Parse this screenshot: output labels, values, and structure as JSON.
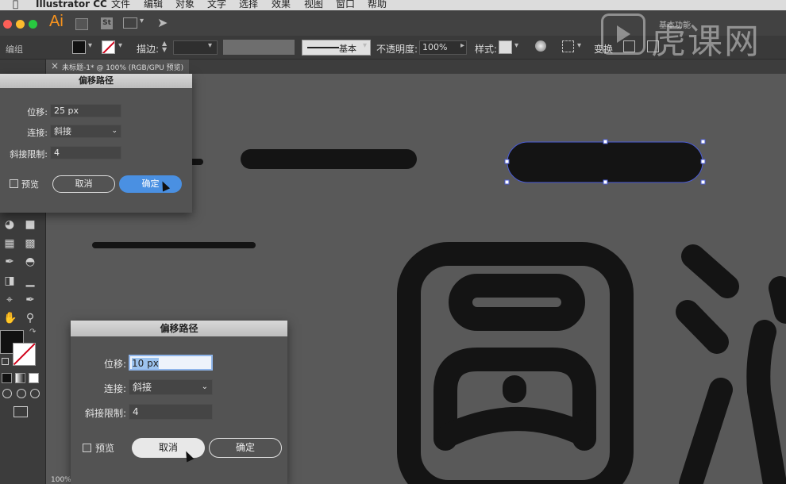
{
  "menubar": {
    "apple_icon": "apple-icon",
    "app_name": "Illustrator CC",
    "items": [
      "文件",
      "编辑",
      "对象",
      "文字",
      "选择",
      "效果",
      "视图",
      "窗口",
      "帮助"
    ]
  },
  "appbar": {
    "logo": "Ai",
    "workspace": "基本功能"
  },
  "control_bar": {
    "selection_label": "编组",
    "stroke_label": "描边:",
    "stroke_style": "基本",
    "opacity_label": "不透明度:",
    "opacity_value": "100%",
    "style_label": "样式:",
    "transform_label": "变换"
  },
  "document_tab": {
    "close": "×",
    "title": "未标题-1* @ 100% (RGB/GPU 预览)"
  },
  "status": {
    "zoom": "100%"
  },
  "watermark": {
    "text": "虎课网"
  },
  "dialog_top": {
    "title": "偏移路径",
    "offset_label": "位移:",
    "offset_value": "25 px",
    "join_label": "连接:",
    "join_value": "斜接",
    "miter_label": "斜接限制:",
    "miter_value": "4",
    "preview_label": "预览",
    "cancel_label": "取消",
    "ok_label": "确定"
  },
  "dialog_bottom": {
    "title": "偏移路径",
    "offset_label": "位移:",
    "offset_value": "10 px",
    "join_label": "连接:",
    "join_value": "斜接",
    "miter_label": "斜接限制:",
    "miter_value": "4",
    "preview_label": "预览",
    "cancel_label": "取消",
    "ok_label": "确定"
  },
  "colors": {
    "accent": "#4a90e2",
    "canvas": "#595959",
    "artwork": "#141414",
    "selection": "#4a5bd6"
  }
}
